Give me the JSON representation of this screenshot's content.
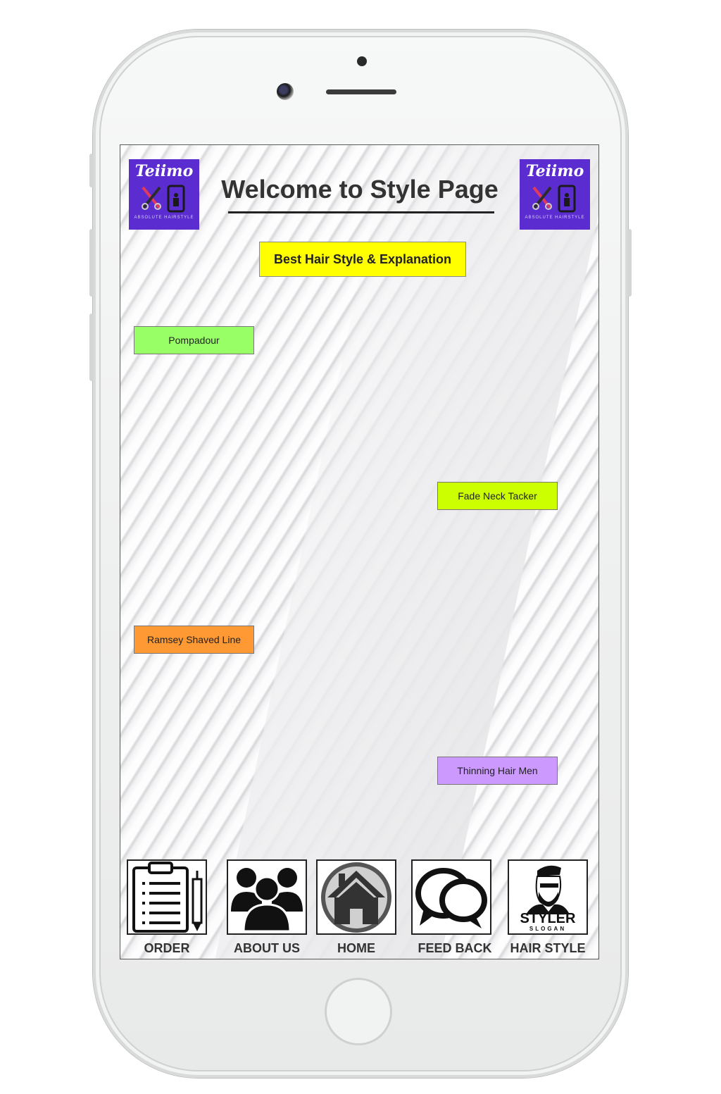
{
  "header": {
    "title": "Welcome to Style Page",
    "tagline": "Best Hair Style & Explanation",
    "logo_brand": "Teiimo",
    "logo_tagline": "ABSOLUTE HAIRSTYLE"
  },
  "styles": [
    {
      "label": "Pompadour",
      "color": "#99ff66"
    },
    {
      "label": "Fade Neck Tacker",
      "color": "#ccff00"
    },
    {
      "label": "Ramsey Shaved Line",
      "color": "#ff9933"
    },
    {
      "label": "Thinning Hair Men",
      "color": "#cc99ff"
    }
  ],
  "nav": [
    {
      "label": "ORDER",
      "icon": "clipboard-icon"
    },
    {
      "label": "ABOUT US",
      "icon": "people-icon"
    },
    {
      "label": "HOME",
      "icon": "home-icon"
    },
    {
      "label": "FEED BACK",
      "icon": "chat-bubbles-icon"
    },
    {
      "label": "HAIR STYLE",
      "icon": "styler-logo-icon",
      "logo_text": "STYLER",
      "logo_subtext": "SLOGAN"
    }
  ],
  "colors": {
    "logo_bg": "#5b2ccf",
    "tagline_bg": "#ffff00"
  }
}
